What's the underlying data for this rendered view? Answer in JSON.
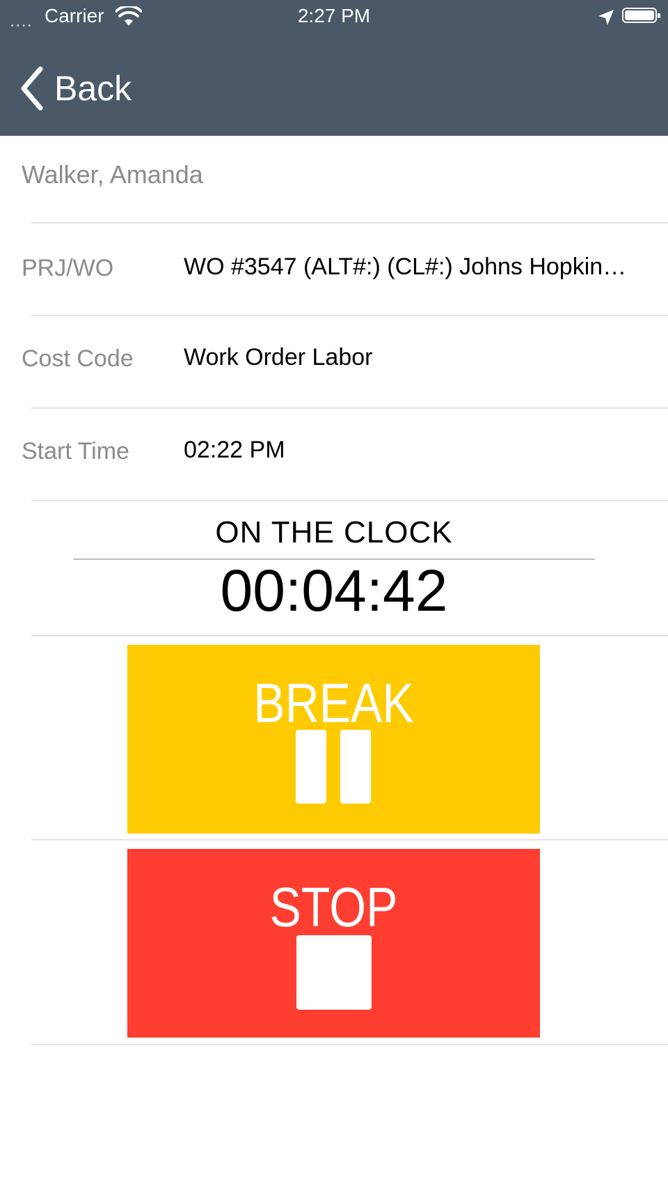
{
  "status_bar": {
    "signal": "....",
    "carrier": "Carrier",
    "time": "2:27 PM"
  },
  "nav": {
    "back_label": "Back"
  },
  "employee_name": "Walker, Amanda",
  "rows": [
    {
      "label": "PRJ/WO",
      "value": "WO #3547 (ALT#:) (CL#:)  Johns Hopkin…"
    },
    {
      "label": "Cost Code",
      "value": "Work Order Labor"
    },
    {
      "label": "Start Time",
      "value": "02:22 PM"
    }
  ],
  "clock": {
    "status": "ON THE CLOCK",
    "elapsed": "00:04:42"
  },
  "buttons": {
    "break_label": "BREAK",
    "stop_label": "STOP"
  },
  "colors": {
    "nav_bg": "#4a5867",
    "break": "#fecb02",
    "stop": "#fd3e31"
  },
  "icons": [
    "wifi-icon",
    "location-arrow-icon",
    "battery-icon",
    "back-chevron-icon",
    "pause-icon",
    "stop-icon"
  ]
}
